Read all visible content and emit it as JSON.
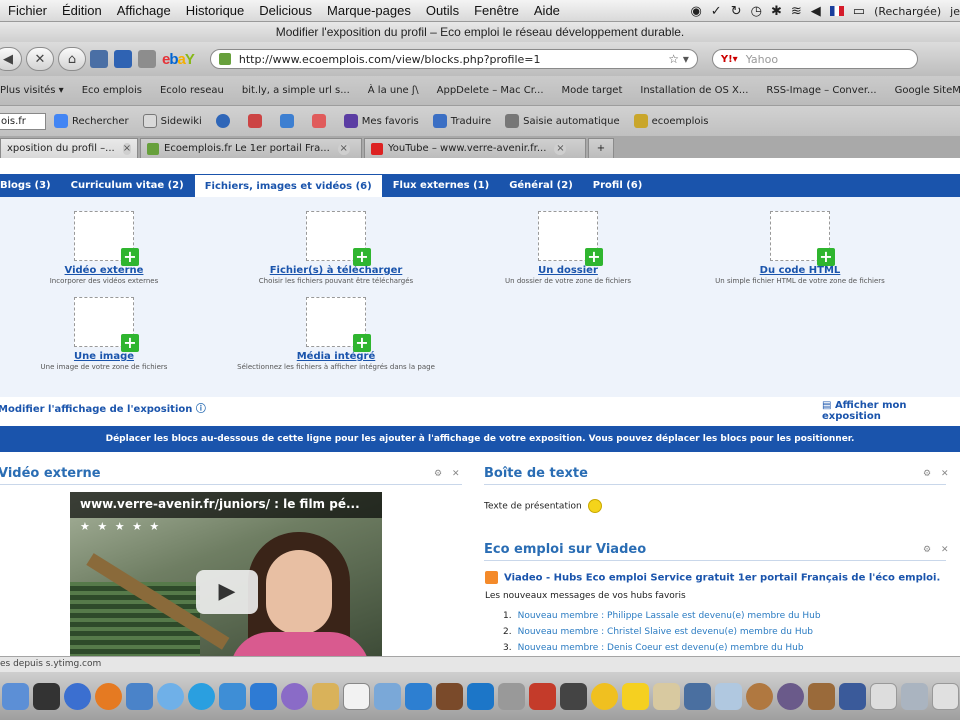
{
  "menubar": {
    "items": [
      "Fichier",
      "Édition",
      "Affichage",
      "Historique",
      "Delicious",
      "Marque-pages",
      "Outils",
      "Fenêtre",
      "Aide"
    ],
    "status_text": "(Rechargée)",
    "status_user": "je"
  },
  "window": {
    "title": "Modifier l'exposition du profil – Eco emploi le réseau développement durable."
  },
  "navbar": {
    "url": "http://www.ecoemplois.com/view/blocks.php?profile=1",
    "search_placeholder": "Yahoo"
  },
  "bookmarks": [
    "Plus visités ▾",
    "Eco emplois",
    "Ecolo reseau",
    "bit.ly, a simple url s...",
    "À la une ʃ\\",
    "AppDelete – Mac Cr...",
    "Mode target",
    "Installation de OS X...",
    "RSS-Image – Conver...",
    "Google SiteMap"
  ],
  "toolbar": {
    "select_value": "ois.fr",
    "items": [
      "Rechercher",
      "Sidewiki",
      "Mes favoris",
      "Traduire",
      "Saisie automatique",
      "ecoemplois"
    ]
  },
  "tabs": [
    {
      "label": "xposition du profil –...",
      "active": true
    },
    {
      "label": "Ecoemplois.fr Le 1er portail Fra...",
      "active": false
    },
    {
      "label": "YouTube – www.verre-avenir.fr...",
      "active": false
    }
  ],
  "profile_tabs": [
    {
      "label": "Blogs (3)",
      "active": false
    },
    {
      "label": "Curriculum vitae (2)",
      "active": false
    },
    {
      "label": "Fichiers, images et vidéos (6)",
      "active": true
    },
    {
      "label": "Flux externes (1)",
      "active": false
    },
    {
      "label": "Général (2)",
      "active": false
    },
    {
      "label": "Profil (6)",
      "active": false
    }
  ],
  "blocks": [
    {
      "title": "Vidéo externe",
      "desc": "Incorporer des vidéos externes"
    },
    {
      "title": "Fichier(s) à télécharger",
      "desc": "Choisir les fichiers pouvant être téléchargés"
    },
    {
      "title": "Un dossier",
      "desc": "Un dossier de votre zone de fichiers"
    },
    {
      "title": "Du code HTML",
      "desc": "Un simple fichier HTML de votre zone de fichiers"
    },
    {
      "title": "Une image",
      "desc": "Une image de votre zone de fichiers"
    },
    {
      "title": "Média intégré",
      "desc": "Sélectionnez les fichiers à afficher intégrés dans la page"
    }
  ],
  "links": {
    "modify_display": "Modifier l'affichage de l'exposition",
    "show_exposition": "Afficher mon exposition"
  },
  "instruction_bar": "Déplacer les blocs au-dessous de cette ligne pour les ajouter à l'affichage de votre exposition. Vous pouvez déplacer les blocs pour les positionner.",
  "panels": {
    "video": {
      "title": "Vidéo externe",
      "video_title": "www.verre-avenir.fr/juniors/ : le film pé...",
      "stars": "★ ★ ★ ★ ★"
    },
    "textbox": {
      "title": "Boîte de texte",
      "text": "Texte de présentation"
    },
    "viadeo": {
      "title": "Eco emploi sur Viadeo",
      "feed_link": "Viadeo - Hubs Eco emploi Service gratuit 1er portail Français de l'éco emploi.",
      "subtitle": "Les nouveaux messages de vos hubs favoris",
      "items": [
        {
          "num": "1.",
          "text": "Nouveau membre : Philippe Lassale est devenu(e) membre du Hub"
        },
        {
          "num": "2.",
          "text": "Nouveau membre : Christel Slaive est devenu(e) membre du Hub"
        },
        {
          "num": "3.",
          "text": "Nouveau membre : Denis Coeur est devenu(e) membre du Hub"
        }
      ]
    }
  },
  "statusbar": {
    "text": "es depuis s.ytimg.com"
  },
  "colors": {
    "brand_blue": "#1a54ac",
    "panel_title": "#2a6db4",
    "block_bg": "#eef3fb"
  },
  "dock_icons": [
    "finder",
    "dashboard",
    "firefox",
    "safari",
    "ichat",
    "skype",
    "mail",
    "tweetdeck",
    "address-book",
    "itunes",
    "preview",
    "ical",
    "iphoto",
    "garageband",
    "vlc",
    "dictionary",
    "photo-booth",
    "adium",
    "textedit",
    "activity-monitor",
    "calculator",
    "keychain",
    "terminal",
    "system-prefs",
    "trash"
  ]
}
